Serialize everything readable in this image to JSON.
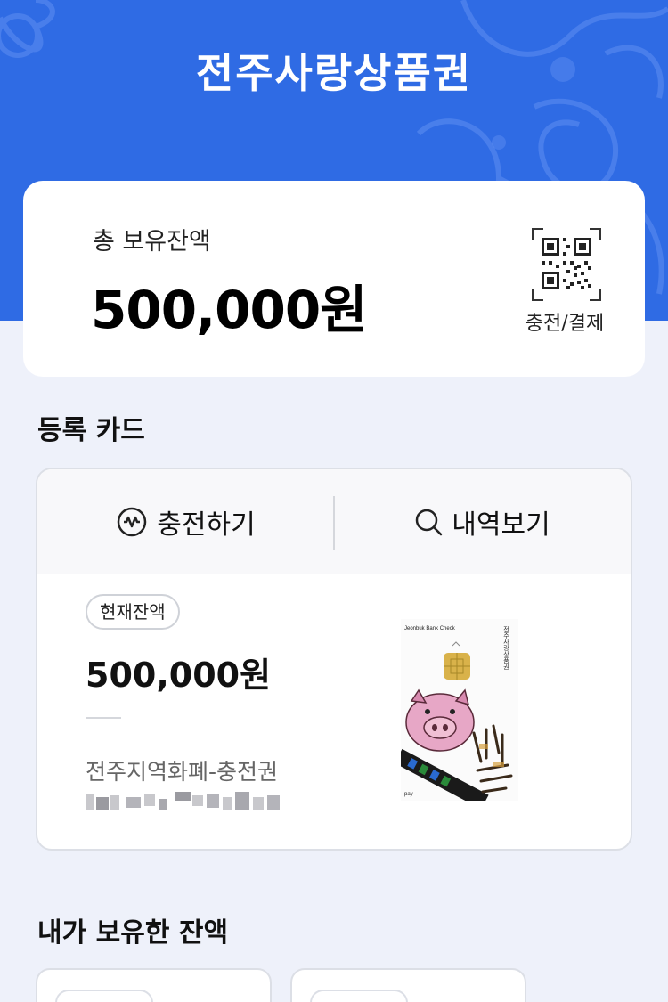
{
  "header": {
    "title": "전주사랑상품권",
    "background_color": "#2f6be4"
  },
  "balance_summary": {
    "label": "총 보유잔액",
    "amount": "500,000원",
    "qr_label": "충전/결제",
    "qr_icon": "qr-code-icon"
  },
  "registered_cards": {
    "section_title": "등록 카드",
    "actions": [
      {
        "label": "충전하기",
        "icon": "won-coin-icon"
      },
      {
        "label": "내역보기",
        "icon": "search-icon"
      }
    ],
    "card": {
      "badge": "현재잔액",
      "amount": "500,000원",
      "name": "전주지역화폐-충전권",
      "card_image": {
        "brand_text": "Jeonbuk Bank Check",
        "vertical_text": "전주사랑상품권",
        "pay_text": "pay"
      }
    }
  },
  "my_balances": {
    "section_title": "내가 보유한 잔액"
  }
}
